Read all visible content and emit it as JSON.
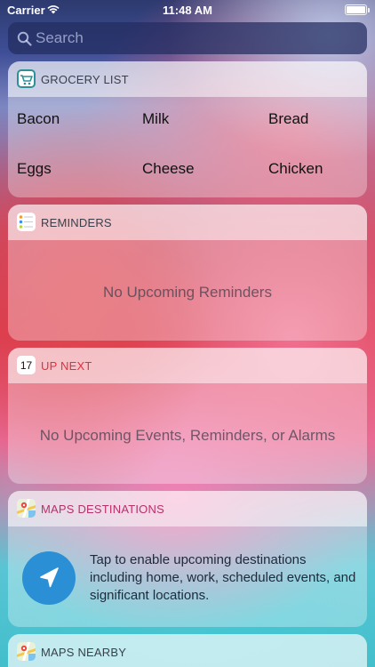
{
  "status_bar": {
    "carrier": "Carrier",
    "time": "11:48 AM",
    "battery_level": 1.0
  },
  "search": {
    "placeholder": "Search"
  },
  "grocery": {
    "title": "GROCERY LIST",
    "items": [
      "Bacon",
      "Milk",
      "Bread",
      "Eggs",
      "Cheese",
      "Chicken"
    ]
  },
  "reminders": {
    "title": "REMINDERS",
    "empty_message": "No Upcoming Reminders"
  },
  "up_next": {
    "title": "UP NEXT",
    "calendar_day": "17",
    "empty_message": "No Upcoming Events, Reminders, or Alarms"
  },
  "maps_destinations": {
    "title": "MAPS DESTINATIONS",
    "message": "Tap to enable upcoming destinations including home, work, scheduled events, and significant locations."
  },
  "maps_nearby": {
    "title": "MAPS NEARBY"
  },
  "colors": {
    "accent_red": "#e2303f",
    "nav_button": "#2b8fd6"
  }
}
